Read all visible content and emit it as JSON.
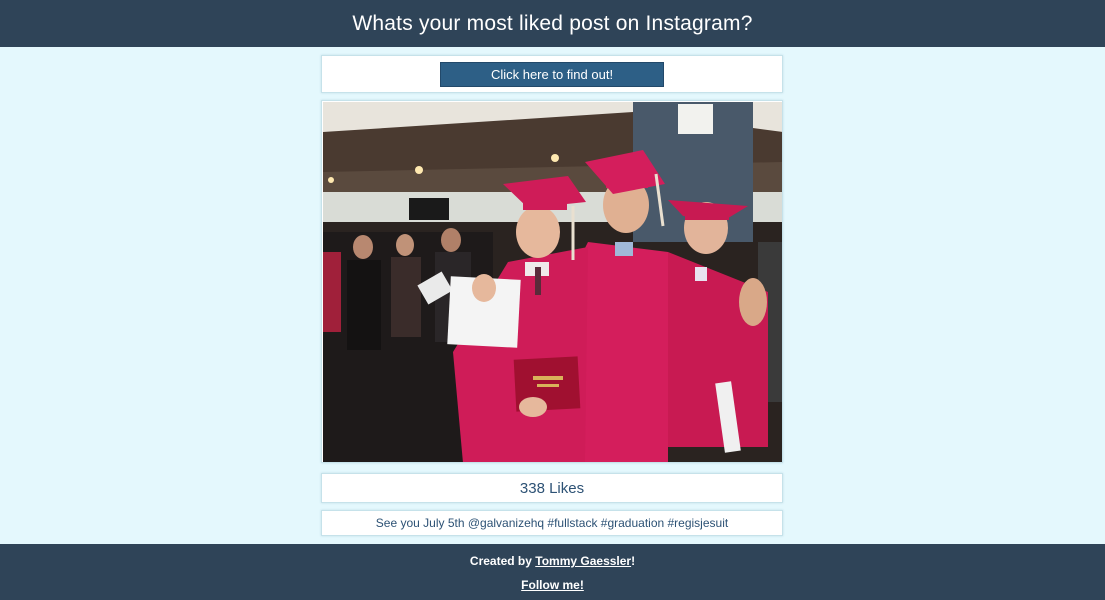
{
  "header": {
    "title": "Whats your most liked post on Instagram?"
  },
  "action": {
    "button_label": "Click here to find out!"
  },
  "post": {
    "likes_text": "338 Likes",
    "caption": "See you July 5th @galvanizehq #fullstack #graduation #regisjesuit"
  },
  "footer": {
    "created_by_prefix": "Created by ",
    "author_name": "Tommy Gaessler",
    "created_by_suffix": "!",
    "follow_label": "Follow me!"
  },
  "colors": {
    "header_bg": "#2f4458",
    "page_bg": "#e4f8fd",
    "button_bg": "#2d5f86",
    "gown": "#d41e5c"
  }
}
